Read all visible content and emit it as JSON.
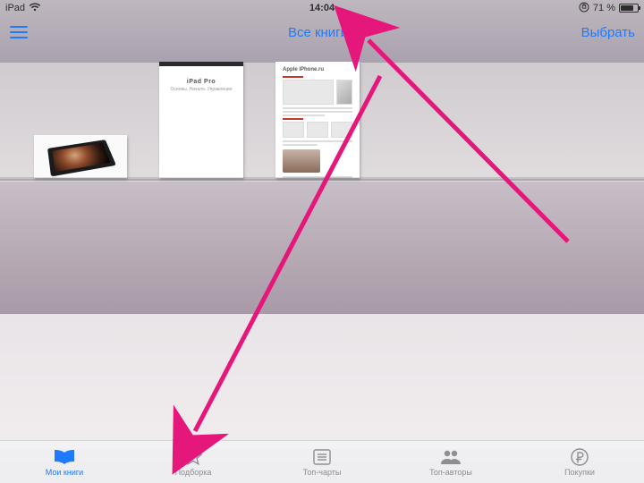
{
  "status": {
    "device": "iPad",
    "time": "14:04",
    "battery_percent": "71 %"
  },
  "navbar": {
    "title": "Все книги",
    "select": "Выбрать"
  },
  "shelf": {
    "book2_title": "iPad Pro",
    "book2_sub": "Основы. Начало. Управление",
    "book3_header": "Apple iPhone.ru"
  },
  "tabs": {
    "mybooks": "Мои книги",
    "featured": "Подборка",
    "topcharts": "Топ-чарты",
    "topauthors": "Топ-авторы",
    "purchased": "Покупки"
  }
}
